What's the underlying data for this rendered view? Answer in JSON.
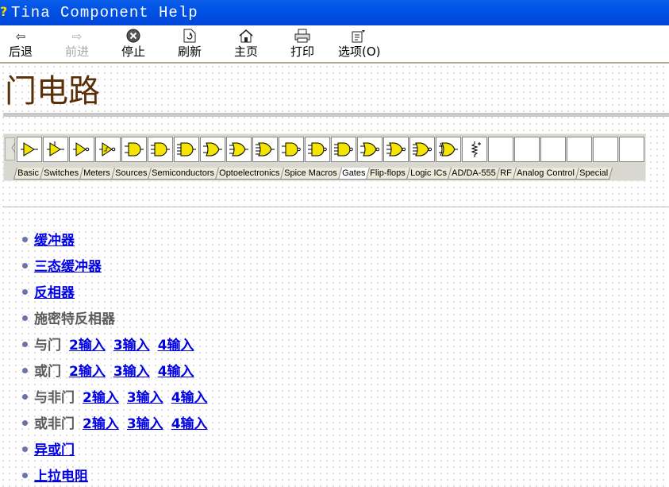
{
  "window": {
    "title": "Tina Component Help",
    "icon": "help-question-icon"
  },
  "toolbar": {
    "buttons": [
      {
        "label": "后退",
        "icon": "back-arrow-icon",
        "enabled": true
      },
      {
        "label": "前进",
        "icon": "forward-arrow-icon",
        "enabled": false
      },
      {
        "label": "停止",
        "icon": "stop-icon",
        "enabled": true
      },
      {
        "label": "刷新",
        "icon": "refresh-icon",
        "enabled": true
      },
      {
        "label": "主页",
        "icon": "home-icon",
        "enabled": true
      },
      {
        "label": "打印",
        "icon": "print-icon",
        "enabled": true
      },
      {
        "label": "选项(O)",
        "icon": "options-icon",
        "enabled": true
      }
    ]
  },
  "page": {
    "title": "门电路"
  },
  "palette": {
    "active_tab": "Gates",
    "tabs": [
      "Basic",
      "Switches",
      "Meters",
      "Sources",
      "Semiconductors",
      "Optoelectronics",
      "Spice Macros",
      "Gates",
      "Flip-flops",
      "Logic ICs",
      "AD/DA-555",
      "RF",
      "Analog Control",
      "Special"
    ],
    "component_icons": [
      "buffer-gate-icon",
      "tristate-buffer-icon",
      "inverter-gate-icon",
      "schmitt-inverter-icon",
      "and2-gate-icon",
      "and3-gate-icon",
      "and4-gate-icon",
      "or2-gate-icon",
      "or3-gate-icon",
      "or4-gate-icon",
      "nand2-gate-icon",
      "nand3-gate-icon",
      "nand4-gate-icon",
      "nor2-gate-icon",
      "nor3-gate-icon",
      "nor4-gate-icon",
      "xor-gate-icon",
      "pullup-resistor-icon"
    ],
    "empty_slots": 6,
    "colors": {
      "gate_fill": "#f5e400",
      "gate_stroke": "#000000"
    }
  },
  "list": {
    "items": [
      {
        "label": "缓冲器",
        "link": true,
        "sublinks": []
      },
      {
        "label": "三态缓冲器",
        "link": true,
        "sublinks": []
      },
      {
        "label": "反相器",
        "link": true,
        "sublinks": []
      },
      {
        "label": "施密特反相器",
        "link": false,
        "sublinks": []
      },
      {
        "label": "与门",
        "link": false,
        "sublinks": [
          "2输入",
          "3输入",
          "4输入"
        ]
      },
      {
        "label": "或门",
        "link": false,
        "sublinks": [
          "2输入",
          "3输入",
          "4输入"
        ]
      },
      {
        "label": "与非门",
        "link": false,
        "sublinks": [
          "2输入",
          "3输入",
          "4输入"
        ]
      },
      {
        "label": "或非门",
        "link": false,
        "sublinks": [
          "2输入",
          "3输入",
          "4输入"
        ]
      },
      {
        "label": "异或门",
        "link": true,
        "sublinks": []
      },
      {
        "label": "上拉电阻",
        "link": true,
        "sublinks": []
      }
    ]
  },
  "colors": {
    "link": "#0000e6",
    "title_text": "#5a2e06",
    "titlebar": "#0052e6",
    "plain_text": "#5a5a5a"
  }
}
